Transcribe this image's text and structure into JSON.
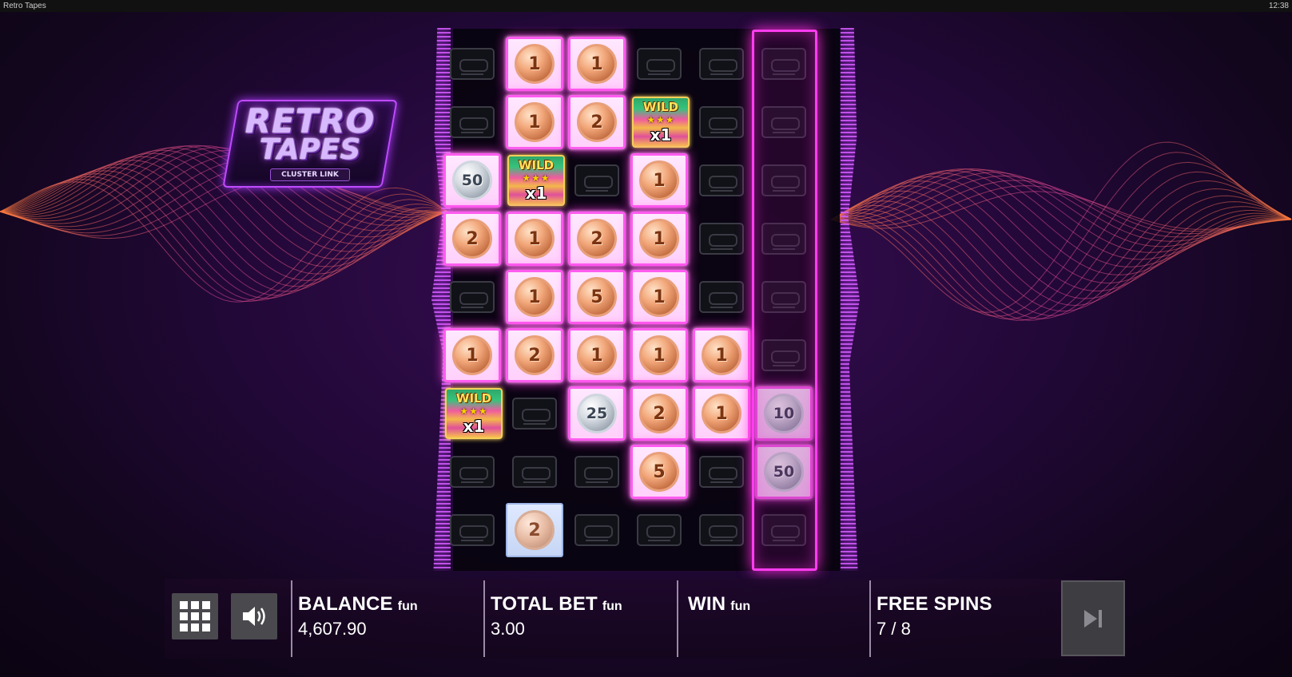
{
  "window": {
    "title": "Retro Tapes",
    "clock": "12:38"
  },
  "logo": {
    "line1": "RETRO",
    "line2": "TAPES",
    "badge": "CLUSTER LINK"
  },
  "grid": {
    "columns": 6,
    "rows": 9,
    "highlighted_column": 6,
    "cells": [
      [
        "empty",
        "c:1",
        "c:1",
        "empty",
        "empty",
        "empty"
      ],
      [
        "empty",
        "c:1",
        "c:2",
        "wild:x1",
        "empty",
        "empty"
      ],
      [
        "s:50",
        "wild:x1",
        "empty",
        "c:1",
        "empty",
        "empty"
      ],
      [
        "c:2",
        "c:1",
        "c:2",
        "c:1",
        "empty",
        "empty"
      ],
      [
        "empty",
        "c:1",
        "c:5",
        "c:1",
        "empty",
        "empty"
      ],
      [
        "c:1",
        "c:2",
        "c:1",
        "c:1",
        "c:1",
        "empty"
      ],
      [
        "wild:x1",
        "empty",
        "s:25",
        "c:2",
        "c:1",
        "s:10"
      ],
      [
        "empty",
        "empty",
        "empty",
        "c:5",
        "empty",
        "s:50"
      ],
      [
        "empty",
        "p:2",
        "empty",
        "empty",
        "empty",
        "empty"
      ]
    ],
    "wild_label": "WILD",
    "wild_stars": "★★★"
  },
  "controls": {
    "menu_icon": "grid-menu-icon",
    "sound_icon": "speaker-icon",
    "skip_icon": "skip-forward-icon"
  },
  "balance": {
    "label": "BALANCE",
    "unit": "fun",
    "value": "4,607.90"
  },
  "total_bet": {
    "label": "TOTAL BET",
    "unit": "fun",
    "value": "3.00"
  },
  "win": {
    "label": "WIN",
    "unit": "fun",
    "value": ""
  },
  "free_spins": {
    "label": "FREE SPINS",
    "value": "7 / 8"
  },
  "colors": {
    "accent": "#ff3cf0",
    "background": "#220838",
    "coin_copper": "#f2a77a",
    "coin_silver": "#d6dbe2"
  }
}
